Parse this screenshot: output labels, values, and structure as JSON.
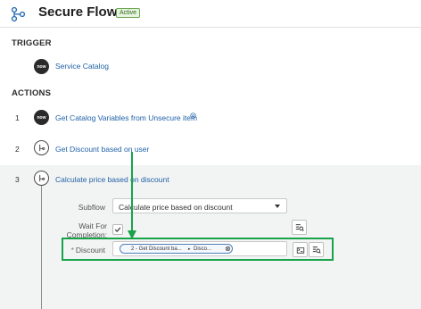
{
  "header": {
    "title": "Secure Flow",
    "status_badge": "Active"
  },
  "trigger": {
    "section_label": "TRIGGER",
    "icon_text": "now",
    "label": "Service Catalog"
  },
  "actions": {
    "section_label": "ACTIONS",
    "rows": [
      {
        "number": "1",
        "icon": "now-icon",
        "icon_text": "now",
        "label": "Get Catalog Variables from Unsecure item",
        "has_info_icon": true
      },
      {
        "number": "2",
        "icon": "subflow-icon",
        "label": "Get Discount based on user"
      },
      {
        "number": "3",
        "icon": "subflow-icon",
        "label": "Calculate price based on discount",
        "expanded": true
      }
    ]
  },
  "expanded_row": {
    "subflow_label": "Subflow",
    "subflow_value": "Calculate price based on discount",
    "wait_label_line1": "Wait For",
    "wait_label_line2": "Completion:",
    "wait_checked": true,
    "discount_required_mark": "*",
    "discount_label": "Discount",
    "discount_pill": {
      "step": "2 - Get Discount ba...",
      "separator": "▸",
      "field": "Disco..."
    }
  },
  "colors": {
    "link": "#2162a8",
    "highlight_box": "#18a34a",
    "arrow": "#18a34a",
    "badge_bg": "#e8f3e2",
    "expanded_bg": "#f2f3f3"
  }
}
